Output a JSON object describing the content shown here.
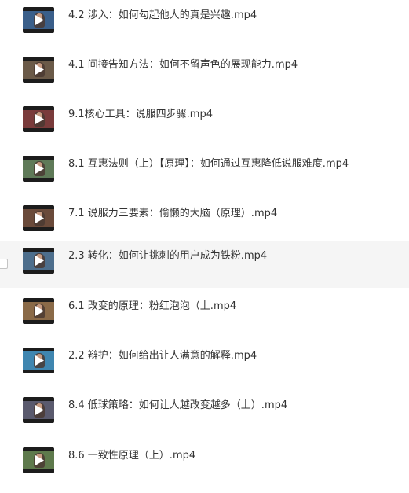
{
  "files": [
    {
      "name": "4.2 涉入：如何勾起他人的真是兴趣.mp4",
      "thumb_bg": "#3a5f8a",
      "play_icon": "play-icon"
    },
    {
      "name": "4.1 间接告知方法：如何不留声色的展现能力.mp4",
      "thumb_bg": "#6b5a48",
      "play_icon": "play-icon"
    },
    {
      "name": "9.1核心工具：说服四步骤.mp4",
      "thumb_bg": "#7a3b3b",
      "play_icon": "play-icon"
    },
    {
      "name": "8.1 互惠法则（上）【原理】：如何通过互惠降低说服难度.mp4",
      "thumb_bg": "#5f7a58",
      "play_icon": "play-icon"
    },
    {
      "name": "7.1 说服力三要素：偷懒的大脑（原理）.mp4",
      "thumb_bg": "#6a4a3a",
      "play_icon": "play-icon"
    },
    {
      "name": "2.3 转化：如何让挑刺的用户成为铁粉.mp4",
      "thumb_bg": "#4d6e8c",
      "play_icon": "play-icon"
    },
    {
      "name": "6.1 改变的原理：粉红泡泡（上.mp4",
      "thumb_bg": "#8a6a48",
      "play_icon": "play-icon"
    },
    {
      "name": "2.2 辩护：如何给出让人满意的解释.mp4",
      "thumb_bg": "#3f86b0",
      "play_icon": "play-icon"
    },
    {
      "name": "8.4 低球策略：如何让人越改变越多（上）.mp4",
      "thumb_bg": "#5a5a6e",
      "play_icon": "play-icon"
    },
    {
      "name": "8.6 一致性原理（上）.mp4",
      "thumb_bg": "#5e7a4c",
      "play_icon": "play-icon"
    }
  ],
  "hovered_index": 5,
  "colors": {
    "text": "#333333",
    "hover_bg": "#f5f5f5",
    "thumb_frame": "#1c1c1c"
  }
}
